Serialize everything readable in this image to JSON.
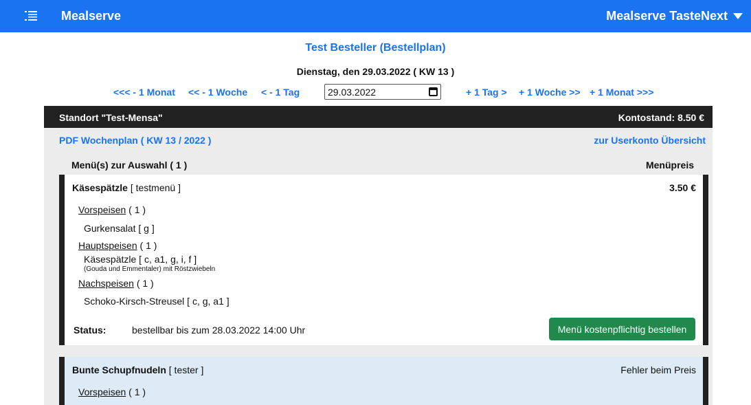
{
  "header": {
    "brand": "Mealserve",
    "app_name": "Mealserve TasteNext"
  },
  "page": {
    "title": "Test Besteller (Bestellplan)",
    "date_line": "Dienstag, den 29.03.2022 ( KW 13 )"
  },
  "date_nav": {
    "minus_month": "<<< - 1 Monat",
    "minus_week": "<< - 1 Woche",
    "minus_day": "< - 1 Tag",
    "date_value": "29.03.2022",
    "plus_day": "+ 1 Tag >",
    "plus_week": "+ 1 Woche >>",
    "plus_month": "+ 1 Monat >>>"
  },
  "location": {
    "name": "Standort \"Test-Mensa\"",
    "balance": "Kontostand: 8.50 €"
  },
  "links": {
    "pdf_plan": "PDF Wochenplan ( KW 13 / 2022 )",
    "account_overview": "zur Userkonto Übersicht"
  },
  "menu_header": {
    "left": "Menü(s) zur Auswahl ( 1 )",
    "right": "Menüpreis"
  },
  "menus": [
    {
      "name": "Käsespätzle",
      "tag": "[ testmenü ]",
      "price": "3.50 €",
      "starters_label": "Vorspeisen",
      "starters_count": "( 1 )",
      "starter_dish": "Gurkensalat [ g ]",
      "mains_label": "Hauptspeisen",
      "mains_count": "( 1 )",
      "main_dish": "Käsespätzle [ c, a1, g, i, f ]",
      "main_note": "(Gouda und Emmentaler) mit Röstzwiebeln",
      "desserts_label": "Nachspeisen",
      "desserts_count": "( 1 )",
      "dessert_dish": "Schoko-Kirsch-Streusel [ c, g, a1 ]",
      "status_label": "Status:",
      "status_text": "bestellbar bis zum 28.03.2022 14:00 Uhr",
      "order_button": "Menü kostenpflichtig bestellen"
    },
    {
      "name": "Bunte Schupfnudeln",
      "tag": "[ tester ]",
      "price": "Fehler beim Preis",
      "starters_label": "Vorspeisen",
      "starters_count": "( 1 )"
    }
  ]
}
